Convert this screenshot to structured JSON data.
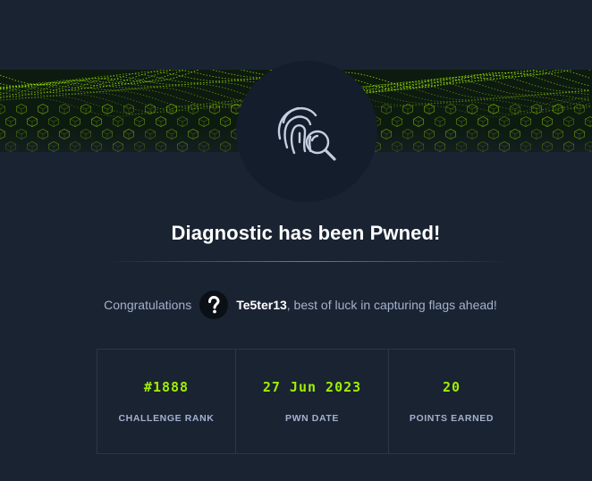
{
  "banner": {
    "accent_color": "#9fef00",
    "style": "green-wireframe-wave"
  },
  "machine": {
    "icon": "fingerprint-search-icon"
  },
  "title": "Diagnostic has been Pwned!",
  "congrats": {
    "prefix": "Congratulations",
    "user_avatar_icon": "question-mark-icon",
    "username": "Te5ter13",
    "suffix": ", best of luck in capturing flags ahead!"
  },
  "stats": [
    {
      "value": "#1888",
      "label": "CHALLENGE RANK"
    },
    {
      "value": "27 Jun 2023",
      "label": "PWN DATE"
    },
    {
      "value": "20",
      "label": "POINTS EARNED"
    }
  ],
  "colors": {
    "background": "#1a2332",
    "accent": "#9fef00",
    "muted_text": "#a4b1cd"
  }
}
